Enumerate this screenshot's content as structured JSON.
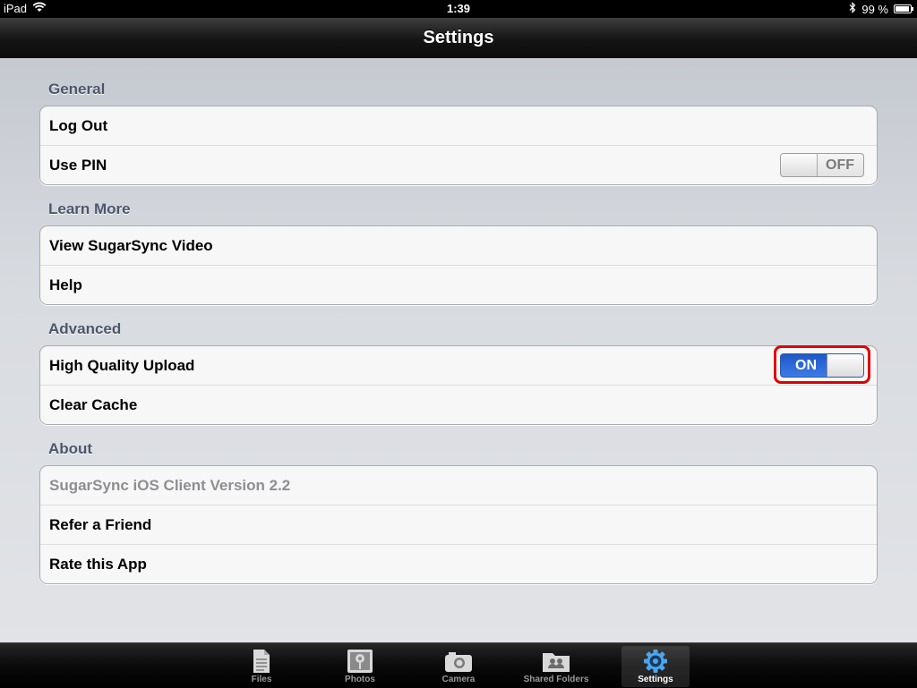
{
  "status": {
    "device": "iPad",
    "time": "1:39",
    "battery": "99 %"
  },
  "navbar": {
    "title": "Settings"
  },
  "sections": {
    "general": {
      "header": "General",
      "log_out": "Log Out",
      "use_pin": "Use PIN",
      "use_pin_switch": "OFF"
    },
    "learn_more": {
      "header": "Learn More",
      "video": "View SugarSync Video",
      "help": "Help"
    },
    "advanced": {
      "header": "Advanced",
      "hq_upload": "High Quality Upload",
      "hq_upload_switch": "ON",
      "clear_cache": "Clear Cache"
    },
    "about": {
      "header": "About",
      "version": "SugarSync iOS Client Version 2.2",
      "refer": "Refer a Friend",
      "rate": "Rate this App"
    }
  },
  "tabs": [
    {
      "label": "Files",
      "icon": "document-icon"
    },
    {
      "label": "Photos",
      "icon": "photos-icon"
    },
    {
      "label": "Camera",
      "icon": "camera-icon"
    },
    {
      "label": "Shared Folders",
      "icon": "shared-folder-icon"
    },
    {
      "label": "Settings",
      "icon": "gear-icon",
      "selected": true
    }
  ],
  "colors": {
    "switch_on": "#2f6fe0",
    "highlight": "#e00000",
    "section_header": "#4c566c"
  }
}
